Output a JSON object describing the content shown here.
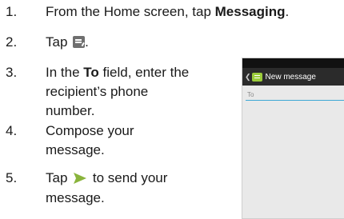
{
  "steps": [
    {
      "num": "1.",
      "text_before": "From the Home screen, tap ",
      "bold": "Messaging",
      "text_after": "."
    },
    {
      "num": "2.",
      "text_before": "Tap ",
      "icon": "compose-icon",
      "text_after": "."
    },
    {
      "num": "3.",
      "line1_before": "In the ",
      "line1_bold": "To",
      "line1_after": " field, enter the",
      "line2": "recipient’s phone",
      "line3": "number."
    },
    {
      "num": "4.",
      "line1": "Compose your",
      "line2": "message."
    },
    {
      "num": "5.",
      "line1_before": "Tap ",
      "icon": "send-icon",
      "line1_after": " to send your",
      "line2": "message."
    }
  ],
  "phone": {
    "title": "New message",
    "to_placeholder": "To",
    "accent": "#3ea8d4",
    "icon_color": "#9bcc3a"
  }
}
